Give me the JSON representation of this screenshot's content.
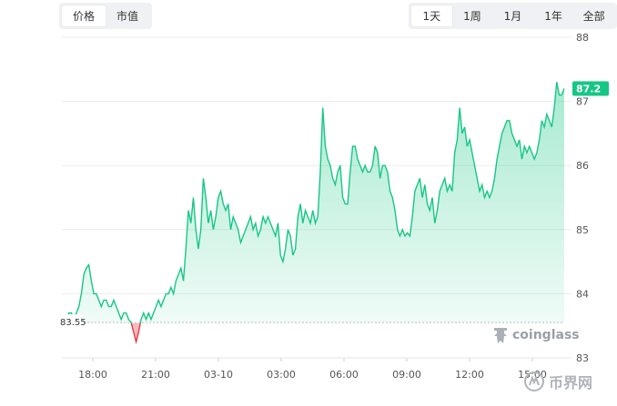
{
  "tabs_left": [
    {
      "label": "价格",
      "active": true
    },
    {
      "label": "市值",
      "active": false
    }
  ],
  "tabs_right": [
    {
      "label": "1天",
      "active": true
    },
    {
      "label": "1周",
      "active": false
    },
    {
      "label": "1月",
      "active": false
    },
    {
      "label": "1年",
      "active": false
    },
    {
      "label": "全部",
      "active": false
    }
  ],
  "brand": {
    "name": "coinglass",
    "icon": "coinglass-logo-icon"
  },
  "watermark": {
    "text": "币界网",
    "icon": "bijiewang-logo-icon"
  },
  "colors": {
    "up": "#16c784",
    "down": "#ea3943",
    "grid": "#ececec",
    "axis_text": "#555555"
  },
  "chart_data": {
    "type": "area",
    "title": "",
    "xlabel": "",
    "ylabel": "",
    "ylim": [
      83,
      88
    ],
    "yticks": [
      83,
      84,
      85,
      86,
      87,
      88
    ],
    "xticks": [
      "18:00",
      "21:00",
      "03-10",
      "03:00",
      "06:00",
      "09:00",
      "12:00",
      "15:00"
    ],
    "baseline": 83.55,
    "baseline_label": "83.55",
    "last_value": 87.2,
    "last_label": "87.2",
    "y_axis_position": "right",
    "grid": true,
    "series": [
      {
        "values": [
          83.6,
          83.7,
          83.7,
          83.6,
          83.7,
          83.8,
          84.0,
          84.3,
          84.4,
          84.45,
          84.2,
          84.0,
          84.0,
          83.9,
          83.8,
          83.9,
          83.9,
          83.8,
          83.8,
          83.9,
          83.8,
          83.7,
          83.6,
          83.7,
          83.7,
          83.6,
          83.55,
          83.4,
          83.25,
          83.4,
          83.6,
          83.7,
          83.6,
          83.7,
          83.6,
          83.7,
          83.8,
          83.9,
          83.8,
          83.9,
          84.0,
          84.0,
          84.1,
          84.0,
          84.2,
          84.3,
          84.4,
          84.2,
          84.7,
          85.3,
          85.1,
          85.5,
          85.0,
          84.7,
          85.0,
          85.8,
          85.5,
          85.1,
          85.3,
          85.0,
          85.2,
          85.5,
          85.6,
          85.4,
          85.3,
          85.4,
          85.0,
          85.2,
          85.1,
          85.0,
          84.8,
          84.9,
          85.0,
          85.1,
          85.2,
          85.0,
          85.1,
          84.9,
          85.0,
          85.2,
          85.1,
          85.2,
          85.1,
          85.0,
          84.9,
          85.1,
          84.6,
          84.5,
          84.7,
          85.0,
          84.9,
          84.6,
          84.7,
          85.2,
          85.4,
          85.1,
          85.3,
          85.2,
          85.1,
          85.3,
          85.1,
          85.2,
          85.9,
          86.9,
          86.3,
          86.1,
          86.0,
          85.8,
          85.7,
          85.9,
          86.0,
          85.5,
          85.4,
          85.4,
          85.9,
          86.3,
          86.3,
          86.1,
          86.0,
          85.9,
          86.0,
          85.9,
          85.9,
          86.0,
          86.3,
          86.2,
          85.8,
          86.0,
          86.0,
          85.9,
          85.6,
          85.5,
          85.3,
          85.0,
          84.9,
          85.0,
          84.9,
          84.95,
          84.9,
          85.2,
          85.6,
          85.7,
          85.8,
          85.5,
          85.7,
          85.4,
          85.3,
          85.5,
          85.1,
          85.3,
          85.6,
          85.7,
          85.8,
          85.6,
          85.7,
          85.6,
          86.2,
          86.4,
          86.9,
          86.5,
          86.6,
          86.3,
          86.4,
          86.2,
          86.0,
          85.8,
          85.6,
          85.7,
          85.5,
          85.6,
          85.5,
          85.6,
          85.8,
          86.1,
          86.3,
          86.5,
          86.6,
          86.7,
          86.7,
          86.5,
          86.4,
          86.3,
          86.4,
          86.1,
          86.3,
          86.2,
          86.3,
          86.2,
          86.1,
          86.2,
          86.4,
          86.7,
          86.6,
          86.8,
          86.7,
          86.6,
          86.9,
          87.3,
          87.1,
          87.1,
          87.2
        ]
      }
    ]
  }
}
